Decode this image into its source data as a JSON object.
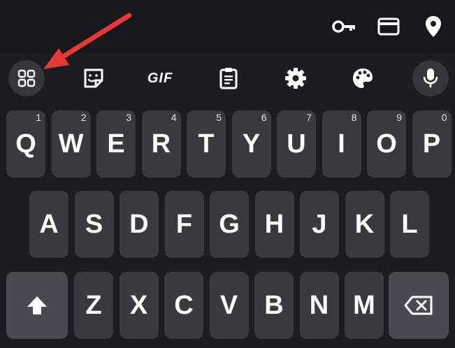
{
  "status_icons": [
    "key-icon",
    "card-icon",
    "location-pin-icon"
  ],
  "toolbar": {
    "gif_label": "GIF",
    "icons": [
      "apps-grid-icon",
      "sticker-icon",
      "gif-icon",
      "clipboard-icon",
      "gear-icon",
      "palette-icon",
      "microphone-icon"
    ]
  },
  "keyboard": {
    "row1": [
      {
        "letter": "Q",
        "hint": "1"
      },
      {
        "letter": "W",
        "hint": "2"
      },
      {
        "letter": "E",
        "hint": "3"
      },
      {
        "letter": "R",
        "hint": "4"
      },
      {
        "letter": "T",
        "hint": "5"
      },
      {
        "letter": "Y",
        "hint": "6"
      },
      {
        "letter": "U",
        "hint": "7"
      },
      {
        "letter": "I",
        "hint": "8"
      },
      {
        "letter": "O",
        "hint": "9"
      },
      {
        "letter": "P",
        "hint": "0"
      }
    ],
    "row2": [
      "A",
      "S",
      "D",
      "F",
      "G",
      "H",
      "J",
      "K",
      "L"
    ],
    "row3": [
      "Z",
      "X",
      "C",
      "V",
      "B",
      "N",
      "M"
    ]
  },
  "colors": {
    "background": "#1d1c21",
    "key": "#3a393e",
    "function_key": "#4a494f",
    "annotation_arrow": "#e53935"
  }
}
